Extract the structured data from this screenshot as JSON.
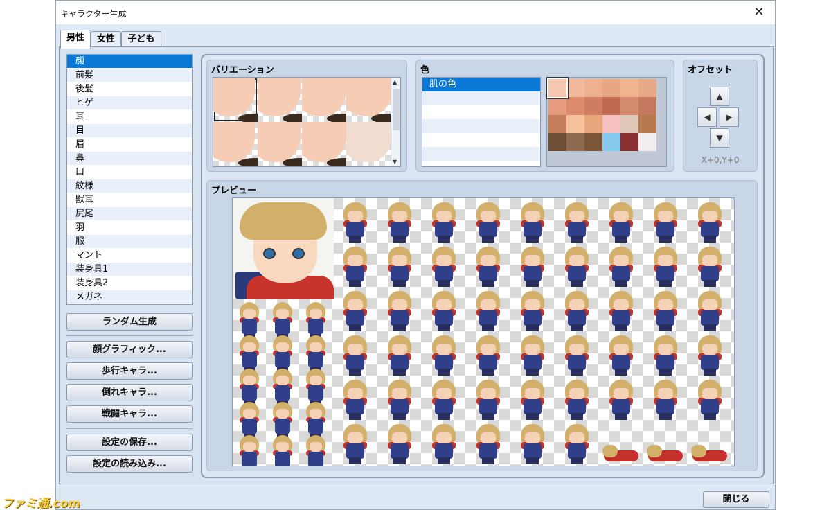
{
  "window": {
    "title": "キャラクター生成",
    "close_glyph": "✕"
  },
  "tabs": [
    "男性",
    "女性",
    "子ども"
  ],
  "parts": {
    "selected_index": 0,
    "items": [
      "顔",
      "前髪",
      "後髪",
      "ヒゲ",
      "耳",
      "目",
      "眉",
      "鼻",
      "口",
      "紋様",
      "獣耳",
      "尻尾",
      "羽",
      "服",
      "マント",
      "装身具1",
      "装身具2",
      "メガネ"
    ]
  },
  "buttons": {
    "random": "ランダム生成",
    "face_graphic": "顔グラフィック...",
    "walk_char": "歩行キャラ...",
    "down_char": "倒れキャラ...",
    "battle_char": "戦闘キャラ...",
    "save_settings": "設定の保存...",
    "load_settings": "設定の読み込み...",
    "close": "閉じる"
  },
  "variation": {
    "label": "バリエーション"
  },
  "color": {
    "label": "色",
    "items": [
      "肌の色"
    ],
    "swatches": [
      [
        "#f5c7b0",
        "#f2b99a",
        "#eeb08e",
        "#e9a683",
        "#f0b58f",
        "#e7aa88"
      ],
      [
        "#e89c7f",
        "#dc8b6c",
        "#cf7d60",
        "#c06a52",
        "#d48a6e",
        "#c57860"
      ],
      [
        "#c57d5a",
        "#f5c29b",
        "#e8a77d",
        "#f7c0c0",
        "#dfc7b7",
        "#b77a4f"
      ],
      [
        "#6e4e36",
        "#8b6a4f",
        "#7b5638",
        "#86cbef",
        "#8a2f31",
        "#f2eef0"
      ]
    ]
  },
  "offset": {
    "label": "オフセット",
    "up": "▲",
    "left": "◀",
    "right": "▶",
    "down": "▼",
    "value": "X+0,Y+0"
  },
  "preview": {
    "label": "プレビュー"
  },
  "watermark": "ファミ通.com"
}
